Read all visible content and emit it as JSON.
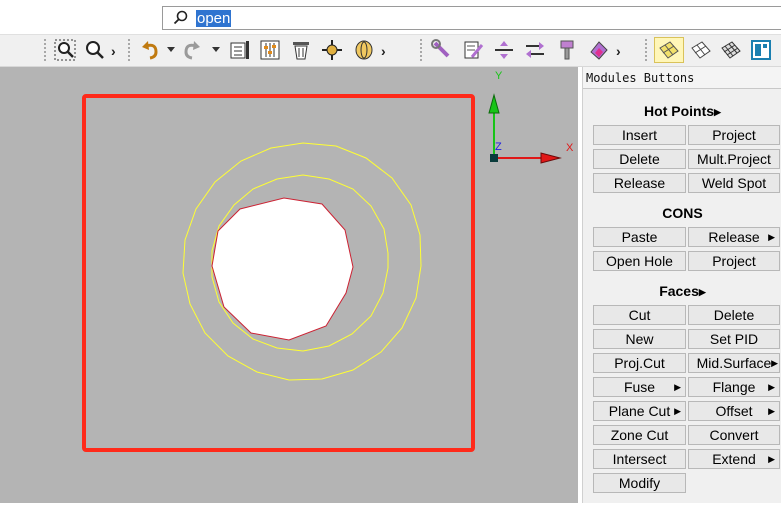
{
  "search": {
    "value": "open"
  },
  "viewport": {
    "background": "#b4b4b4",
    "frame_color": "#ff2a1a",
    "circle_color": "#ffff33",
    "hole_color": "#cc2233",
    "axes": {
      "x_label": "X",
      "y_label": "Y",
      "z_label": "Z"
    }
  },
  "toolbar": {
    "icons": [
      "zoom-window-icon",
      "zoom-icon",
      "undo-icon",
      "redo-icon",
      "list-icon",
      "settings-icon",
      "delete-icon",
      "move-icon",
      "rotate-icon",
      "measure-icon",
      "edit-icon",
      "align-icon",
      "transform-icon",
      "wrench-icon",
      "paint-icon",
      "shaded-icon",
      "wireframe-icon",
      "mesh-icon",
      "plane-icon"
    ]
  },
  "panel": {
    "title": "Modules Buttons",
    "hot_points": {
      "heading": "Hot Points",
      "buttons": [
        "Insert",
        "Project",
        "Delete",
        "Mult.Project",
        "Release",
        "Weld Spot"
      ]
    },
    "cons": {
      "heading": "CONS",
      "buttons": [
        "Paste",
        "Release",
        "Open Hole",
        "Project"
      ]
    },
    "faces": {
      "heading": "Faces",
      "buttons": [
        "Cut",
        "Delete",
        "New",
        "Set PID",
        "Proj.Cut",
        "Mid.Surface",
        "Fuse",
        "Flange",
        "Plane Cut",
        "Offset",
        "Zone Cut",
        "Convert",
        "Intersect",
        "Extend",
        "Modify"
      ]
    }
  }
}
